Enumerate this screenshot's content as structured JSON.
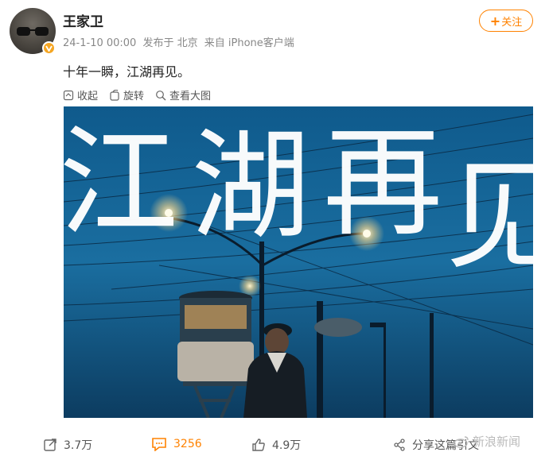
{
  "post": {
    "user_name": "王家卫",
    "timestamp": "24-1-10 00:00",
    "location": "发布于 北京",
    "source": "来自 iPhone客户端",
    "text": "十年一瞬，江湖再见。"
  },
  "follow_button": {
    "plus": "+",
    "label": "关注"
  },
  "toolbar": {
    "collect": "收起",
    "rotate": "旋转",
    "view_large": "查看大图"
  },
  "photo": {
    "title_chars": [
      "江",
      "湖",
      "再",
      "见"
    ]
  },
  "actions": {
    "repost_count": "3.7万",
    "comment_count": "3256",
    "like_count": "4.9万",
    "share_text": "分享这篇引文"
  },
  "watermark": {
    "text": "新浪新闻"
  },
  "colors": {
    "accent": "#ff8200",
    "badge": "#f5a623"
  }
}
